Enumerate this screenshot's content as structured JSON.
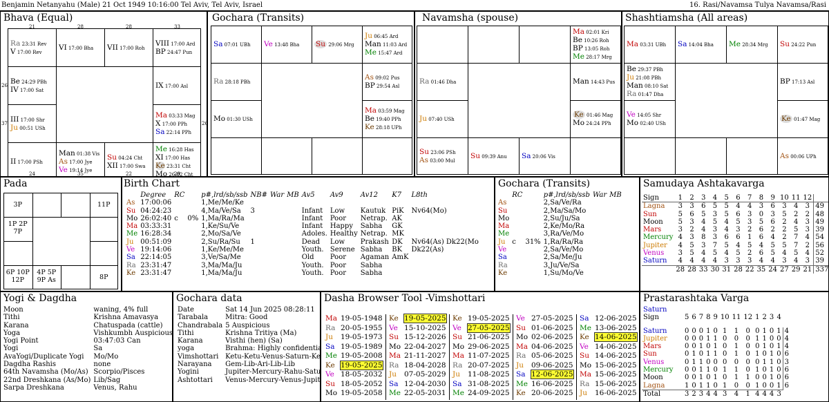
{
  "header": {
    "left": "Benjamin Netanyahu (Male) 21 Oct 1949 10:16:00  Tel Aviv, Tel Aviv, Israel",
    "right": "16. Rasi/Navamsa Tulya Navamsa/Rasi"
  },
  "colors": {
    "Ra": "#6b6b6b",
    "Su": "#c00000",
    "Mo": "#000000",
    "Ma": "#c00000",
    "Me": "#008000",
    "Ju": "#cc7a00",
    "Ve": "#c000c0",
    "Sa": "#0000c0",
    "Ke": "#6b3a00",
    "As": "#a05010",
    "highlight": "#ffff33"
  },
  "bhava": {
    "title": "Bhava (Equal)",
    "top_nums": [
      "21",
      "28",
      "28",
      "33"
    ],
    "bottom_nums": [
      "24",
      "35",
      "22",
      "29"
    ],
    "left_nums": [
      "26",
      "37"
    ],
    "right_nums": [
      "26"
    ],
    "houses": [
      {
        "lines": [
          "Ra 23:31 Rev",
          "V 17:00 Rev"
        ]
      },
      {
        "lines": [
          "VI 17:00 Bha"
        ]
      },
      {
        "lines": [
          "VII 17:00 Roh"
        ]
      },
      {
        "lines": [
          "VIII 17:00 Ard",
          "BP 24:47 Pun"
        ]
      },
      {
        "lines": [
          "Be 24:29 PBh",
          "IV 17:00 Sat"
        ]
      },
      {
        "lines": [
          "IX 17:00 Asl"
        ]
      },
      {
        "lines": [
          "III 17:00 Shr",
          "Ju 00:51 USh"
        ]
      },
      {
        "lines": [
          "Ma 03:33 Mag",
          "X 17:00 PPh",
          "Sa 22:14 PPh"
        ]
      },
      {
        "lines": [
          "II 17:00 PSh"
        ]
      },
      {
        "lines": [
          "Man 01:38 Vis",
          "As 17:00 Jye",
          "Ve 19:14 Jye"
        ]
      },
      {
        "lines": [
          "Su 04:24 Cht",
          "XII 17:00 Swa"
        ]
      },
      {
        "lines": [
          "Me 16:28 Has",
          "XI 17:00 Has",
          "Ke 23:31 Cht",
          "Mo 26:02 Cht"
        ]
      }
    ]
  },
  "gochara_chart": {
    "title": "Gochara (Transits)",
    "cells": [
      {
        "lines": [
          "Sa 07:01 UBh"
        ]
      },
      {
        "lines": [
          "Ve 13:48 Bha"
        ]
      },
      {
        "lines": [
          "Su 29:06 Mrg"
        ]
      },
      {
        "lines": [
          "Ju 06:45 Ard",
          "Man 11:03 Ard",
          "Me 15:47 Ard"
        ]
      },
      {
        "lines": [
          "Ra 28:18 PBh"
        ]
      },
      {
        "lines": [
          "As 09:02 Pus",
          "BP 29:54 Asl"
        ]
      },
      {
        "lines": [
          "Mo 01:30 USh"
        ]
      },
      {
        "lines": [
          "Ma 03:59 Mag",
          "Be 19:40 PPh",
          "Ke 28:18 UPh"
        ]
      },
      {
        "lines": []
      },
      {
        "lines": []
      },
      {
        "lines": []
      },
      {
        "lines": []
      }
    ]
  },
  "navamsha_chart": {
    "title": "Navamsha  (spouse)",
    "cells": [
      {
        "lines": []
      },
      {
        "lines": []
      },
      {
        "lines": []
      },
      {
        "lines": [
          "Ma 02:01 Kri",
          "Be 10:26 Roh",
          "BP 13:05 Roh",
          "Me 28:17 Mrg"
        ]
      },
      {
        "lines": [
          "Ra 01:46 Dha"
        ]
      },
      {
        "lines": [
          "Man 14:43 Pus"
        ]
      },
      {
        "lines": [
          "Ju 07:40 USh"
        ]
      },
      {
        "lines": [
          "Ke 01:46 Mag",
          "Mo 24:24 PPh"
        ]
      },
      {
        "lines": [
          "Su 23:06 PSh",
          "As 03:00 Mul"
        ]
      },
      {
        "lines": [
          "Su 09:39 Anu"
        ]
      },
      {
        "lines": [
          "Sa 20:06 Vis"
        ]
      },
      {
        "lines": []
      }
    ]
  },
  "shashtiamsha_chart": {
    "title": "Shashtiamsha  (All areas)",
    "cells": [
      {
        "lines": [
          "Ma 03:31 UBh"
        ]
      },
      {
        "lines": [
          "Sa 14:04 Bha"
        ]
      },
      {
        "lines": [
          "Me 28:34 Mrg"
        ]
      },
      {
        "lines": [
          "Su 24:22 Pun"
        ]
      },
      {
        "lines": [
          "Be 29:37 PBh",
          "Ju 21:08 PBh",
          "Man 08:10 Sat",
          "Ra 01:47 Dha"
        ]
      },
      {
        "lines": [
          "BP 17:13 Asl"
        ]
      },
      {
        "lines": [
          "Ve 14:05 Shr",
          "Mo 02:40 USh"
        ]
      },
      {
        "lines": [
          "Ke 01:47 Mag"
        ]
      },
      {
        "lines": []
      },
      {
        "lines": []
      },
      {
        "lines": []
      },
      {
        "lines": [
          "As 00:06 UPh"
        ]
      }
    ]
  },
  "pada": {
    "title": "Pada",
    "cells": [
      "3P",
      "",
      "",
      "11P",
      "1P 2P 7P",
      "",
      "",
      "",
      "6P 10P 12P",
      "4P 5P 9P As",
      "",
      "8P"
    ]
  },
  "birth": {
    "title": "Birth Chart",
    "headers": [
      "",
      "Degree",
      "RC",
      "",
      "p#,lrd/sb/ssb",
      "NB#",
      "War",
      "MB",
      "Av5",
      "Av9",
      "Av12",
      "K7",
      "L8th"
    ],
    "rows": [
      [
        "As",
        "17:00:06",
        "",
        "",
        "1,Me/Me/Ke",
        "",
        "",
        "",
        "",
        "",
        "",
        "",
        ""
      ],
      [
        "Su",
        "04:24:23",
        "",
        "",
        "4,Ma/Ve/Sa",
        "3",
        "",
        "",
        "Infant",
        "Low",
        "Kautuk",
        "PiK",
        "Nv64(Mo)"
      ],
      [
        "Mo",
        "26:02:40",
        "c",
        "0%",
        "1,Ma/Ra/Ma",
        "",
        "",
        "",
        "Infant",
        "Poor",
        "Netrap.",
        "AK",
        ""
      ],
      [
        "Ma",
        "03:33:31",
        "",
        "",
        "1,Ke/Su/Ve",
        "",
        "",
        "",
        "Infant",
        "Happy",
        "Sabha",
        "GK",
        ""
      ],
      [
        "Me",
        "16:28:34",
        "",
        "",
        "2,Mo/Sa/Ve",
        "",
        "",
        "",
        "Adoles.",
        "Healthy",
        "Netrap.",
        "MK",
        ""
      ],
      [
        "Ju",
        "00:51:09",
        "",
        "",
        "2,Su/Ra/Su",
        "1",
        "",
        "",
        "Dead",
        "Low",
        "Prakash",
        "DK",
        "Nv64(As) Dk22(Mo"
      ],
      [
        "Ve",
        "19:14:06",
        "",
        "",
        "1,Ke/Me/Me",
        "",
        "",
        "",
        "Youth.",
        "Serene",
        "Sabha",
        "BK",
        "Dk22(As)"
      ],
      [
        "Sa",
        "22:14:05",
        "",
        "",
        "3,Ve/Sa/Me",
        "",
        "",
        "",
        "Old",
        "Poor",
        "Agaman",
        "AmK",
        ""
      ],
      [
        "Ra",
        "23:31:47",
        "",
        "",
        "3,Ma/Ma/Ju",
        "",
        "",
        "",
        "Youth.",
        "Poor",
        "Sabha",
        "",
        ""
      ],
      [
        "Ke",
        "23:31:47",
        "",
        "",
        "1,Ma/Ma/Ju",
        "",
        "",
        "",
        "Youth.",
        "Poor",
        "Sabha",
        "",
        ""
      ]
    ]
  },
  "gtransit": {
    "title": "Gochara (Transits)",
    "headers": [
      "",
      "RC",
      "",
      "p#,lrd/sb/ssb",
      "War",
      "MB"
    ],
    "rows": [
      [
        "As",
        "",
        "",
        "2,Sa/Ve/Ra"
      ],
      [
        "Su",
        "",
        "",
        "2,Ma/Sa/Mo"
      ],
      [
        "Mo",
        "",
        "",
        "2,Su/Ju/Sa"
      ],
      [
        "Ma",
        "",
        "",
        "2,Ke/Mo/Ra"
      ],
      [
        "Me",
        "",
        "",
        "3,Ra/Ve/Mo"
      ],
      [
        "Ju",
        "c",
        "31%",
        "1,Ra/Ra/Ra"
      ],
      [
        "Ve",
        "",
        "",
        "2,Sa/Ve/Mo"
      ],
      [
        "Sa",
        "",
        "",
        "2,Sa/Me/Ju"
      ],
      [
        "Ra",
        "",
        "",
        "3,Ju/Ve/Sa"
      ],
      [
        "Ke",
        "",
        "",
        "1,Su/Mo/Ve"
      ]
    ]
  },
  "samudaya": {
    "title": "Samudaya Ashtakavarga",
    "rows": [
      {
        "label": "Sign",
        "cls": "",
        "vals": [
          "1",
          "2",
          "3",
          "4",
          "5",
          "6",
          "7",
          "8",
          "9",
          "10",
          "11",
          "12"
        ],
        "total": ""
      },
      {
        "label": "Lagna",
        "cls": "cAs",
        "vals": [
          "3",
          "3",
          "6",
          "5",
          "5",
          "4",
          "4",
          "3",
          "6",
          "3",
          "4",
          "3"
        ],
        "total": "49"
      },
      {
        "label": "Sun",
        "cls": "cSu",
        "vals": [
          "5",
          "6",
          "5",
          "3",
          "5",
          "6",
          "3",
          "0",
          "3",
          "5",
          "2",
          "2"
        ],
        "total": "48"
      },
      {
        "label": "Moon",
        "cls": "cMo",
        "vals": [
          "5",
          "3",
          "4",
          "5",
          "4",
          "5",
          "3",
          "5",
          "6",
          "2",
          "4",
          "3"
        ],
        "total": "49"
      },
      {
        "label": "Mars",
        "cls": "cMa",
        "vals": [
          "3",
          "2",
          "4",
          "3",
          "4",
          "3",
          "2",
          "6",
          "2",
          "2",
          "5",
          "3"
        ],
        "total": "39"
      },
      {
        "label": "Mercury",
        "cls": "cMe",
        "vals": [
          "4",
          "3",
          "8",
          "3",
          "6",
          "6",
          "1",
          "6",
          "4",
          "2",
          "7",
          "4"
        ],
        "total": "54"
      },
      {
        "label": "Jupiter",
        "cls": "cJu",
        "vals": [
          "4",
          "5",
          "3",
          "7",
          "5",
          "4",
          "5",
          "4",
          "5",
          "5",
          "7",
          "2"
        ],
        "total": "56"
      },
      {
        "label": "Venus",
        "cls": "cVe",
        "vals": [
          "3",
          "5",
          "4",
          "5",
          "4",
          "5",
          "2",
          "6",
          "5",
          "4",
          "5",
          "4"
        ],
        "total": "52"
      },
      {
        "label": "Saturn",
        "cls": "cSa",
        "vals": [
          "4",
          "4",
          "4",
          "4",
          "3",
          "3",
          "3",
          "4",
          "4",
          "3",
          "4",
          "3"
        ],
        "total": "39"
      },
      {
        "label": "",
        "cls": "",
        "vals": [
          "28",
          "28",
          "33",
          "30",
          "31",
          "28",
          "22",
          "35",
          "24",
          "27",
          "29",
          "21"
        ],
        "total": "337"
      }
    ]
  },
  "yogi": {
    "title": "Yogi & Dagdha",
    "rows": [
      [
        "Moon",
        "waning, 4% full"
      ],
      [
        "Tithi",
        "Krishna Amavasya"
      ],
      [
        "Karana",
        "Chatuspada (cattle)"
      ],
      [
        "Yoga",
        "Vishkumbh Auspicious"
      ],
      [
        "Yogi Point",
        "03:47:03 Can"
      ],
      [
        "Yogi",
        "Sa"
      ],
      [
        "AvaYogi/Duplicate Yogi",
        "Mo/Mo"
      ],
      [
        "Dagdha Rashis",
        "none"
      ],
      [
        "64th Navamsha (Mo/As)",
        "Scorpio/Pisces"
      ],
      [
        "22nd Dreshkana (As/Mo)",
        "Lib/Sag"
      ],
      [
        "Sarpa Dreshkana",
        "Venus, Rahu"
      ]
    ]
  },
  "gdata": {
    "title": "Gochara data",
    "rows": [
      [
        "Date",
        "Sat 14 Jun 2025  08:28:11"
      ],
      [
        "Tarabala",
        "Mitra: Good"
      ],
      [
        "Chandrabala",
        "5 Auspicious"
      ],
      [
        "Tithi",
        "Krishna Tritiya (Ma)"
      ],
      [
        "Karana",
        "Visthi (hen) (Sa)"
      ],
      [
        "yoga",
        "Brahma: Highly confidential,"
      ],
      [
        "Vimshottari",
        "Ketu-Ketu-Venus-Saturn-Ket"
      ],
      [
        "Narayana",
        "Gem-Lib-Ari-Lib-Lib"
      ],
      [
        "Yogini",
        "Jupiter-Mercury-Rahu-Satur"
      ],
      [
        "Ashtottari",
        "Venus-Mercury-Venus-Jupite"
      ]
    ]
  },
  "dasha": {
    "title": "Dasha Browser Tool -Vimshottari",
    "columns": [
      [
        [
          "Ma",
          "19-05-1948",
          false
        ],
        [
          "Ra",
          "20-05-1955",
          false
        ],
        [
          "Ju",
          "19-05-1973",
          false
        ],
        [
          "Sa",
          "19-05-1989",
          false
        ],
        [
          "Me",
          "19-05-2008",
          false
        ],
        [
          "Ke",
          "19-05-2025",
          true
        ],
        [
          "Ve",
          "18-05-2032",
          false
        ],
        [
          "Su",
          "18-05-2052",
          false
        ],
        [
          "Mo",
          "19-05-2058",
          false
        ]
      ],
      [
        [
          "Ke",
          "19-05-2025",
          true
        ],
        [
          "Ve",
          "15-10-2025",
          false
        ],
        [
          "Su",
          "15-12-2026",
          false
        ],
        [
          "Mo",
          "22-04-2027",
          false
        ],
        [
          "Ma",
          "21-11-2027",
          false
        ],
        [
          "Ra",
          "18-04-2028",
          false
        ],
        [
          "Ju",
          "07-05-2029",
          false
        ],
        [
          "Sa",
          "12-04-2030",
          false
        ],
        [
          "Me",
          "22-05-2031",
          false
        ]
      ],
      [
        [
          "Ke",
          "19-05-2025",
          false
        ],
        [
          "Ve",
          "27-05-2025",
          true
        ],
        [
          "Su",
          "21-06-2025",
          false
        ],
        [
          "Mo",
          "29-06-2025",
          false
        ],
        [
          "Ma",
          "11-07-2025",
          false
        ],
        [
          "Ra",
          "20-07-2025",
          false
        ],
        [
          "Ju",
          "11-08-2025",
          false
        ],
        [
          "Sa",
          "31-08-2025",
          false
        ],
        [
          "Me",
          "24-09-2025",
          false
        ]
      ],
      [
        [
          "Ve",
          "27-05-2025",
          false
        ],
        [
          "Su",
          "01-06-2025",
          false
        ],
        [
          "Mo",
          "02-06-2025",
          false
        ],
        [
          "Ma",
          "04-06-2025",
          false
        ],
        [
          "Ra",
          "05-06-2025",
          false
        ],
        [
          "Ju",
          "09-06-2025",
          false
        ],
        [
          "Sa",
          "12-06-2025",
          true
        ],
        [
          "Me",
          "16-06-2025",
          false
        ],
        [
          "Ke",
          "20-06-2025",
          false
        ]
      ],
      [
        [
          "Sa",
          "12-06-2025",
          false
        ],
        [
          "Me",
          "13-06-2025",
          false
        ],
        [
          "Ke",
          "14-06-2025",
          true
        ],
        [
          "Ve",
          "14-06-2025",
          false
        ],
        [
          "Su",
          "14-06-2025",
          false
        ],
        [
          "Mo",
          "15-06-2025",
          false
        ],
        [
          "Ma",
          "15-06-2025",
          false
        ],
        [
          "Ra",
          "15-06-2025",
          false
        ],
        [
          "Ju",
          "16-06-2025",
          false
        ]
      ]
    ]
  },
  "prastar": {
    "title": "Prastarashtaka Varga",
    "caption": "Saturn",
    "sign_label": "Sign",
    "signs": [
      "5",
      "6",
      "7",
      "8",
      "9",
      "10",
      "11",
      "12",
      "1",
      "2",
      "3",
      "4"
    ],
    "rows": [
      {
        "label": "Saturn",
        "cls": "cSa",
        "vals": [
          "0",
          "0",
          "0",
          "1",
          "0",
          "1",
          "1",
          "0",
          "0",
          "1",
          "0",
          "1"
        ],
        "total": "4"
      },
      {
        "label": "Jupiter",
        "cls": "cJu",
        "vals": [
          "0",
          "0",
          "0",
          "1",
          "1",
          "0",
          "0",
          "0",
          "1",
          "1",
          "0",
          "0"
        ],
        "total": "4"
      },
      {
        "label": "Mars",
        "cls": "cMa",
        "vals": [
          "0",
          "0",
          "1",
          "0",
          "1",
          "0",
          "1",
          "0",
          "0",
          "1",
          "0",
          "1"
        ],
        "total": "4"
      },
      {
        "label": "Sun",
        "cls": "cSu",
        "vals": [
          "0",
          "1",
          "0",
          "1",
          "1",
          "0",
          "1",
          "0",
          "1",
          "0",
          "1",
          "0"
        ],
        "total": "6"
      },
      {
        "label": "Venus",
        "cls": "cVe",
        "vals": [
          "0",
          "1",
          "1",
          "0",
          "0",
          "0",
          "0",
          "0",
          "0",
          "1",
          "1",
          "0"
        ],
        "total": "3"
      },
      {
        "label": "Mercury",
        "cls": "cMe",
        "vals": [
          "0",
          "0",
          "1",
          "1",
          "0",
          "1",
          "1",
          "0",
          "1",
          "0",
          "1",
          "0"
        ],
        "total": "6"
      },
      {
        "label": "Moon",
        "cls": "cMo",
        "vals": [
          "0",
          "0",
          "1",
          "0",
          "1",
          "0",
          "1",
          "1",
          "0",
          "0",
          "1",
          "0"
        ],
        "total": "6"
      },
      {
        "label": "Lagna",
        "cls": "cAs",
        "vals": [
          "1",
          "0",
          "1",
          "1",
          "0",
          "1",
          "0",
          "0",
          "1",
          "0",
          "0",
          "1"
        ],
        "total": "6"
      }
    ],
    "total_label": "Total",
    "totals": [
      "3",
      "2",
      "3",
      "4",
      "4",
      "3",
      "4",
      "1",
      "4",
      "4",
      "4",
      "3"
    ]
  }
}
